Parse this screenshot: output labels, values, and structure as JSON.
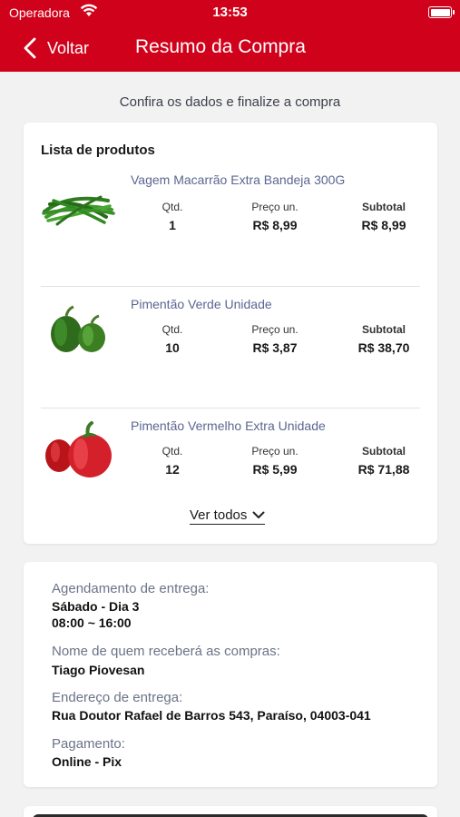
{
  "status_bar": {
    "carrier": "Operadora",
    "time": "13:53"
  },
  "nav": {
    "back_label": "Voltar",
    "title": "Resumo da Compra"
  },
  "subtitle": "Confira os dados e finalize a compra",
  "products_card": {
    "title": "Lista de produtos",
    "qty_label": "Qtd.",
    "unit_price_label": "Preço un.",
    "subtotal_label": "Subtotal",
    "items": [
      {
        "name": "Vagem Macarrão Extra Bandeja 300G",
        "qty": "1",
        "unit_price": "R$ 8,99",
        "subtotal": "R$ 8,99",
        "icon": "green-beans-image"
      },
      {
        "name": "Pimentão Verde Unidade",
        "qty": "10",
        "unit_price": "R$ 3,87",
        "subtotal": "R$ 38,70",
        "icon": "green-pepper-image"
      },
      {
        "name": "Pimentão Vermelho Extra Unidade",
        "qty": "12",
        "unit_price": "R$ 5,99",
        "subtotal": "R$ 71,88",
        "icon": "red-pepper-image"
      }
    ],
    "see_all_label": "Ver todos"
  },
  "delivery_card": {
    "schedule_label": "Agendamento de entrega:",
    "schedule_day": "Sábado - Dia 3",
    "schedule_time": "08:00 ~ 16:00",
    "receiver_label": "Nome de quem receberá as compras:",
    "receiver_name": "Tiago Piovesan",
    "address_label": "Endereço de entrega:",
    "address": "Rua Doutor Rafael de Barros 543, Paraíso, 04003-041",
    "payment_label": "Pagamento:",
    "payment": "Online - Pix"
  },
  "colors": {
    "brand_red": "#d0021b",
    "product_name": "#5b6690",
    "label_gray": "#6b7389"
  }
}
